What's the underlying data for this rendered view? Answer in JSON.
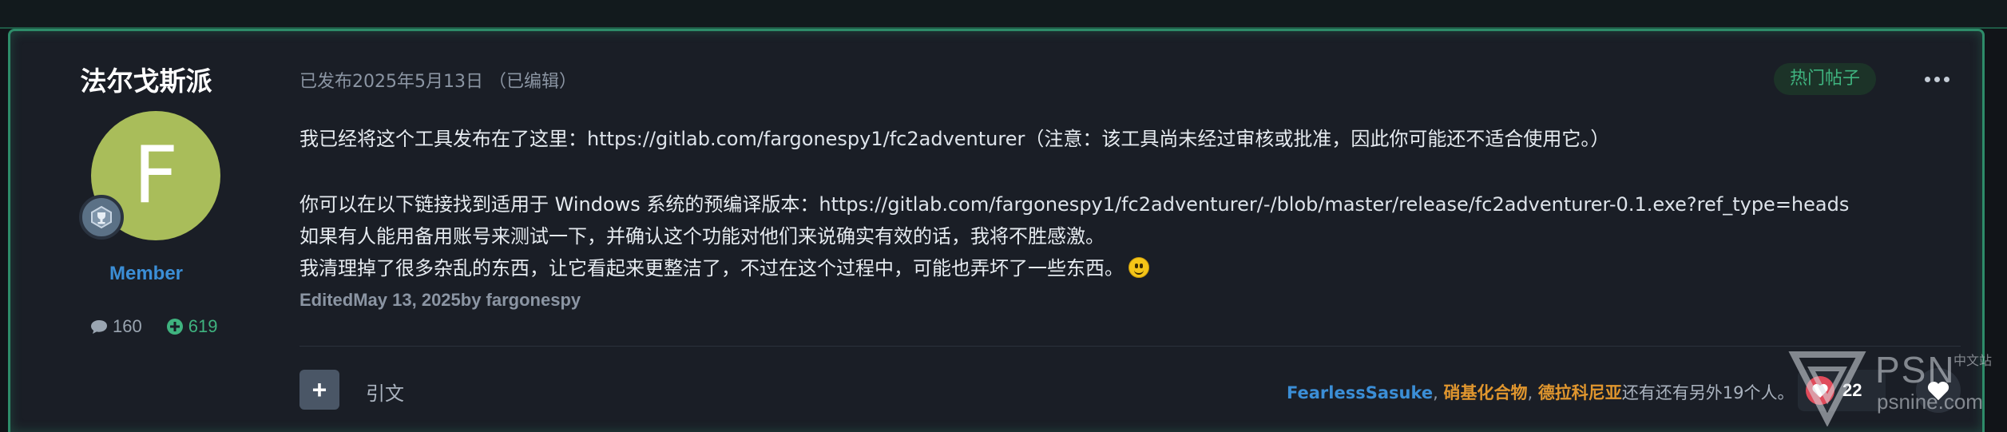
{
  "colors": {
    "accent_border": "#2e8c69",
    "link_blue": "#3b8ed6",
    "liker_orange": "#e0962e",
    "reputation_green": "#3fb37f",
    "avatar_bg": "#a9bd5a",
    "like_red": "#e04b5b"
  },
  "author": {
    "name": "法尔戈斯派",
    "avatar_letter": "F",
    "role": "Member",
    "posts_count": "160",
    "reputation": "619",
    "icons": {
      "rank": "trophy-badge-icon",
      "posts": "comment-icon",
      "reputation": "plus-circle-icon"
    }
  },
  "post": {
    "date": "已发布2025年5月13日 （已编辑）",
    "badge": "热门帖子",
    "more_icon": "ellipsis-icon",
    "lines": {
      "l1_prefix": "我已经将这个工具发布在了这里：",
      "l1_link": "https://gitlab.com/fargonespy1/fc2adventurer",
      "l1_suffix": "（注意：该工具尚未经过审核或批准，因此你可能还不适合使用它。）",
      "l2_prefix": "你可以在以下链接找到适用于 Windows 系统的预编译版本：",
      "l2_link": "https://gitlab.com/fargonespy1/fc2adventurer/-/blob/master/release/fc2adventurer-0.1.exe?ref_type=heads",
      "l3": "如果有人能用备用账号来测试一下，并确认这个功能对他们来说确实有效的话，我将不胜感激。",
      "l4": "我清理掉了很多杂乱的东西，让它看起来更整洁了，不过在这个过程中，可能也弄坏了一些东西。",
      "emoji": "smiley-icon",
      "edited": "EditedMay 13, 2025by fargonespy"
    }
  },
  "footer": {
    "add_icon": "plus-icon",
    "add_label": "+",
    "quote_label": "引文",
    "likers": [
      "FearlessSasuke",
      "硝基化合物",
      "德拉科尼亚"
    ],
    "separator": ", ",
    "likers_more": "还有还有另外19个人。",
    "reaction_icon": "heart-icon",
    "reaction_count": "22",
    "react_button_icon": "heart-outline-icon"
  },
  "watermark": {
    "brand": "PSN",
    "subtitle": "中文站",
    "domain": "psnine.com"
  }
}
